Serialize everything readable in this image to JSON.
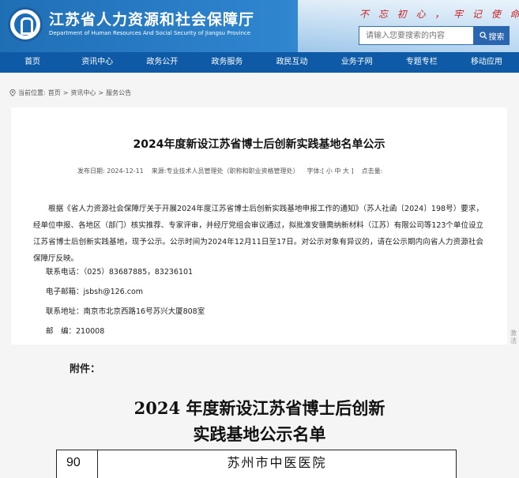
{
  "header": {
    "title": "江苏省人力资源和社会保障厅",
    "subtitle": "Department of Human Resources And Social Security of Jiangsu Province",
    "slogan": "不 忘 初 心 ， 牢 记 使 命",
    "search_placeholder": "请输入您要搜索的内容",
    "search_button": "搜索"
  },
  "nav": {
    "items": [
      "首页",
      "资讯中心",
      "政务公开",
      "政务服务",
      "政民互动",
      "业务子网",
      "专题专栏",
      "移动应用"
    ]
  },
  "breadcrumb": {
    "label": "当前位置:",
    "items": [
      "首页",
      "资讯中心",
      "服务公告"
    ],
    "separator": ">"
  },
  "article": {
    "title": "2024年度新设江苏省博士后创新实践基地名单公示",
    "date_label": "发布日期:",
    "date": "2024-12-11",
    "source_label": "来源:",
    "source": "专业技术人员管理处（职称和职业资格管理处）",
    "font_label": "字体:",
    "font_sizes": "[ 小 中 大 ]",
    "views_label": "点击量:",
    "body": "根据《省人力资源社会保障厅关于开展2024年度江苏省博士后创新实践基地申报工作的通知》（苏人社函〔2024〕198号）要求，经单位申报、各地区（部门）核实推荐、专家评审，并经厅党组会审议通过，拟批准安赣需纳新材料（江苏）有限公司等123个单位设立江苏省博士后创新实践基地，现予公示。公示时间为2024年12月11日至17日。对公示对象有异议的，请在公示期内向省人力资源社会保障厅反映。",
    "phone": "联系电话：（025）83687885，83236101",
    "email": "电子邮箱：jsbsh@126.com",
    "address": "联系地址：南京市北京西路16号苏兴大厦808室",
    "postcode": "邮　编：210008"
  },
  "attachment": {
    "label": "附件：",
    "doc_title_line1": "2024 年度新设江苏省博士后创新",
    "doc_title_line2": "实践基地公示名单",
    "row_number": "90",
    "row_name": "苏州市中医医院"
  },
  "side_tab": "激活"
}
